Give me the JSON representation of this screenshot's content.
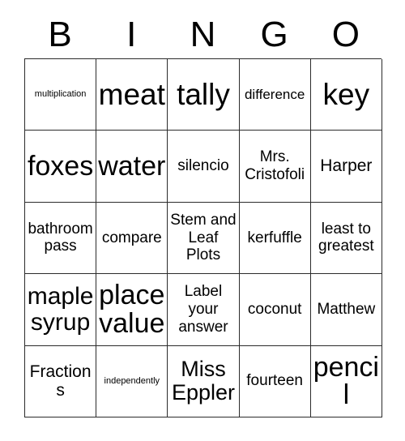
{
  "card": {
    "header_letters": [
      "B",
      "I",
      "N",
      "G",
      "O"
    ],
    "border_color": "#2b2b2b",
    "background_color": "#ffffff",
    "text_color": "#000000",
    "rows": [
      [
        {
          "text": "multiplication",
          "size": "sz-xs"
        },
        {
          "text": "meat",
          "size": "sz-max"
        },
        {
          "text": "tally",
          "size": "sz-max"
        },
        {
          "text": "difference",
          "size": "sz-s"
        },
        {
          "text": "key",
          "size": "sz-max"
        }
      ],
      [
        {
          "text": "foxes",
          "size": "sz-xxl"
        },
        {
          "text": "water",
          "size": "sz-xxl"
        },
        {
          "text": "silencio",
          "size": "sz-m"
        },
        {
          "text": "Mrs. Cristofoli",
          "size": "sz-m"
        },
        {
          "text": "Harper",
          "size": "sz-ml"
        }
      ],
      [
        {
          "text": "bathroom pass",
          "size": "sz-m"
        },
        {
          "text": "compare",
          "size": "sz-m"
        },
        {
          "text": "Stem and Leaf Plots",
          "size": "sz-m"
        },
        {
          "text": "kerfuffle",
          "size": "sz-m"
        },
        {
          "text": "least to greatest",
          "size": "sz-m"
        }
      ],
      [
        {
          "text": "maple syrup",
          "size": "sz-xl"
        },
        {
          "text": "place value",
          "size": "sz-xxl"
        },
        {
          "text": "Label your answer",
          "size": "sz-m"
        },
        {
          "text": "coconut",
          "size": "sz-m"
        },
        {
          "text": "Matthew",
          "size": "sz-m"
        }
      ],
      [
        {
          "text": "Fractions",
          "size": "sz-ml"
        },
        {
          "text": "independently",
          "size": "sz-xs"
        },
        {
          "text": "Miss Eppler",
          "size": "sz-l"
        },
        {
          "text": "fourteen",
          "size": "sz-m"
        },
        {
          "text": "pencil",
          "size": "sz-xxl"
        }
      ]
    ]
  }
}
